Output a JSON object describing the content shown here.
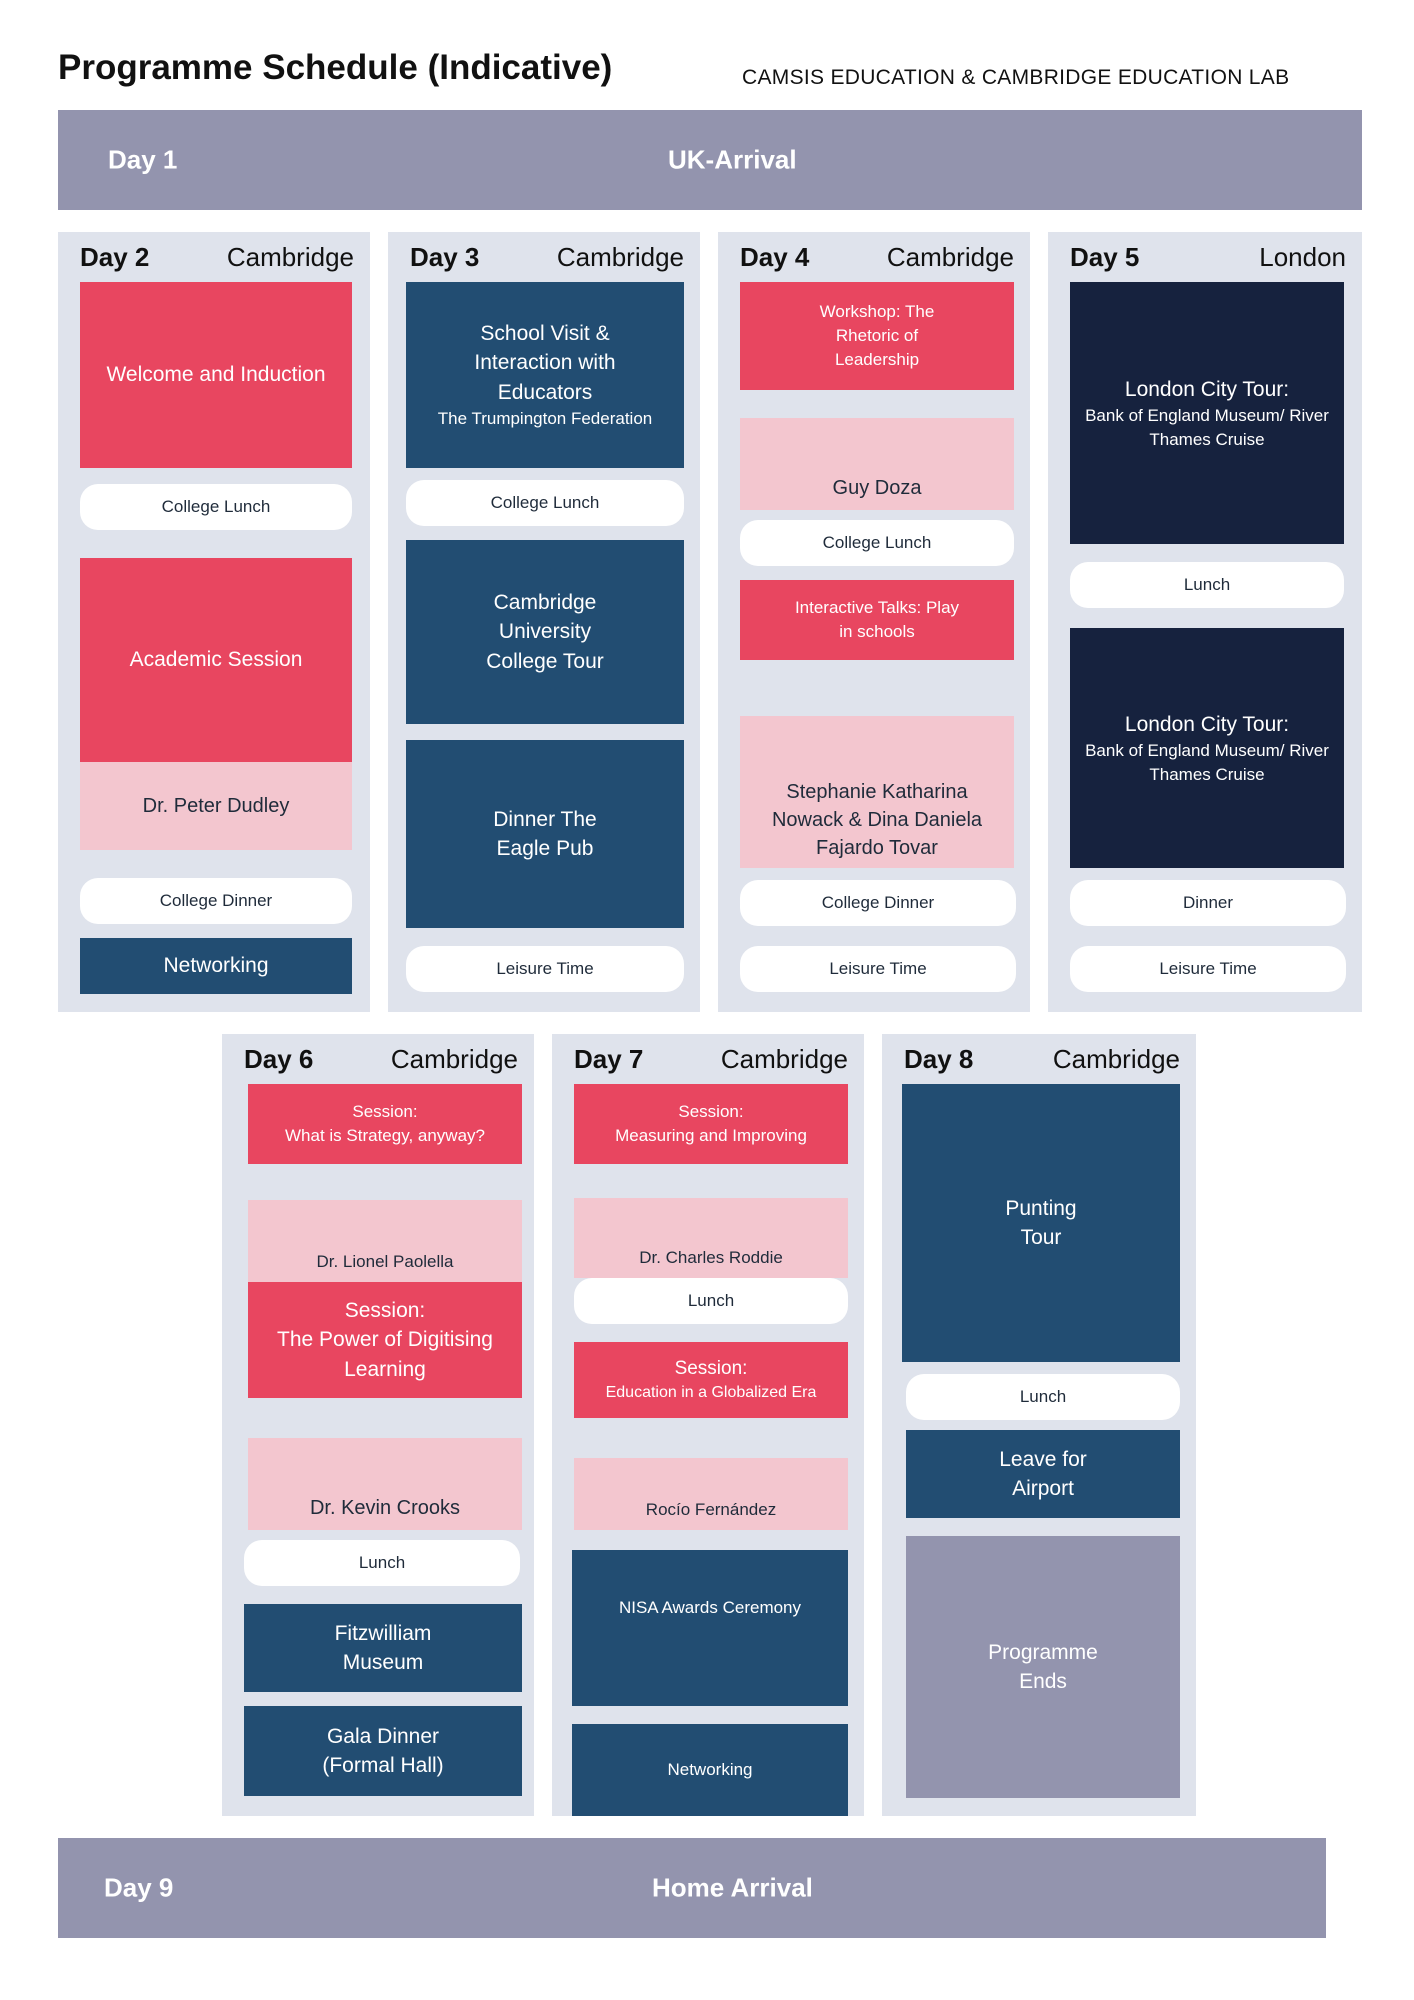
{
  "header": {
    "title": "Programme Schedule (Indicative)",
    "organisers": "CAMSIS EDUCATION &  CAMBRIDGE EDUCATION LAB"
  },
  "arrival": {
    "day": "Day 1",
    "label": "UK-Arrival"
  },
  "departure": {
    "day": "Day 9",
    "label": "Home Arrival"
  },
  "days": [
    {
      "day": "Day 2",
      "location": "Cambridge",
      "items": [
        "Welcome and Induction",
        "College Lunch",
        "Academic Session",
        "Dr. Peter Dudley",
        "College Dinner",
        "Networking"
      ]
    },
    {
      "day": "Day 3",
      "location": "Cambridge",
      "items": [
        "School Visit & Interaction with Educators",
        "The Trumpington Federation",
        "College Lunch",
        "Cambridge University College Tour",
        "Dinner The Eagle Pub",
        "Leisure Time"
      ]
    },
    {
      "day": "Day 4",
      "location": "Cambridge",
      "items": [
        "Workshop: The Rhetoric of Leadership",
        "Guy Doza",
        "College Lunch",
        "Interactive Talks: Play in schools",
        "Stephanie Katharina Nowack & Dina Daniela Fajardo Tovar",
        "College Dinner",
        "Leisure Time"
      ]
    },
    {
      "day": "Day 5",
      "location": "London",
      "items": [
        "London City Tour:",
        "Bank of England Museum/ River Thames Cruise",
        "Lunch",
        "London City Tour:",
        "Bank of England Museum/ River Thames Cruise",
        "Dinner",
        "Leisure Time"
      ]
    },
    {
      "day": "Day 6",
      "location": "Cambridge",
      "items": [
        "Session:",
        "What is Strategy, anyway?",
        "Dr. Lionel Paolella",
        "Session:",
        "The Power of Digitising Learning",
        "Dr. Kevin Crooks",
        "Lunch",
        "Fitzwilliam Museum",
        "Gala Dinner (Formal Hall)"
      ]
    },
    {
      "day": "Day 7",
      "location": "Cambridge",
      "items": [
        "Session:",
        "Measuring and Improving",
        "Dr. Charles Roddie",
        "Lunch",
        "Session:",
        "Education in a Globalized Era",
        "Rocío Fernández",
        "NISA Awards Ceremony",
        "Networking"
      ]
    },
    {
      "day": "Day 8",
      "location": "Cambridge",
      "items": [
        "Punting Tour",
        "Lunch",
        "Leave for Airport",
        "Programme Ends"
      ]
    }
  ],
  "colors": {
    "red": "#e84660",
    "navy": "#224d72",
    "dark_navy": "#16223e",
    "pink": "#f3c6cf",
    "grey": "#9394ae",
    "column_bg": "#dfe3ec"
  }
}
